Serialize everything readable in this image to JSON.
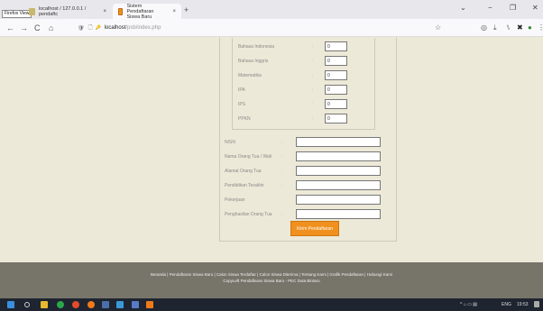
{
  "browser": {
    "firefox_view_label": "Firefox View",
    "tabs": [
      {
        "title": "localhost / 127.0.0.1 / pendaftc",
        "close": "×"
      },
      {
        "title": "Sistem Pendaftaran Siswa Baru",
        "close": "×"
      }
    ],
    "new_tab": "+",
    "window_controls": {
      "list": "⌄",
      "minimize": "−",
      "maximize": "❐",
      "close": "✕"
    },
    "nav": {
      "back": "←",
      "forward": "→",
      "reload": "C",
      "home": "⌂"
    },
    "url": {
      "shield": "🛡",
      "page": "🗋",
      "lock": "🔑",
      "host": "localhost",
      "path": "/psb/index.php"
    },
    "bookmark_star": "☆",
    "right_icons": {
      "pocket": "◎",
      "downloads": "⤓",
      "library": "⑊",
      "extension_x": "✖",
      "extension_dot": "●",
      "menu": "⋮"
    }
  },
  "colors": {
    "accent": "#f0901e",
    "page_bg": "#ede9d8",
    "footer_bg": "#77756a",
    "taskbar_bg": "#1e2530"
  },
  "nilai": [
    {
      "label": "Bahasa Indonesia",
      "colon": ":",
      "value": "0"
    },
    {
      "label": "Bahasa Inggris",
      "colon": ":",
      "value": "0"
    },
    {
      "label": "Matematika",
      "colon": ":",
      "value": "0"
    },
    {
      "label": "IPA",
      "colon": ":",
      "value": "0"
    },
    {
      "label": "IPS",
      "colon": ":",
      "value": "0"
    },
    {
      "label": "PPKN",
      "colon": ":",
      "value": "0"
    }
  ],
  "form": [
    {
      "label": "NISN",
      "colon": ":",
      "value": ""
    },
    {
      "label": "Nama Orang Tua / Wali",
      "colon": ":",
      "value": ""
    },
    {
      "label": "Alamat Orang Tua",
      "colon": ":",
      "value": ""
    },
    {
      "label": "Pendidikan Terakhir",
      "colon": ":",
      "value": ""
    },
    {
      "label": "Pekerjaan",
      "colon": ":",
      "value": ""
    },
    {
      "label": "Penghasilan Orang Tua",
      "colon": ":",
      "value": ""
    }
  ],
  "submit_label": "Kirim Pendaftaran",
  "footer": {
    "links": "Beranda | Pendaftaran Siswa Baru | Calon Siswa Terdaftar | Calon Siswa Diterima | Tentang Kami | Grafik Pendaftaran | Hubungi Kami",
    "copyright": "CopyLeft Pendaftaran Siswa Baru - PEC Duta Bintaro"
  },
  "taskbar": {
    "lang": "ENG",
    "time": "19:53",
    "tray_icons": "^ ⌂ ▭ ▤"
  }
}
